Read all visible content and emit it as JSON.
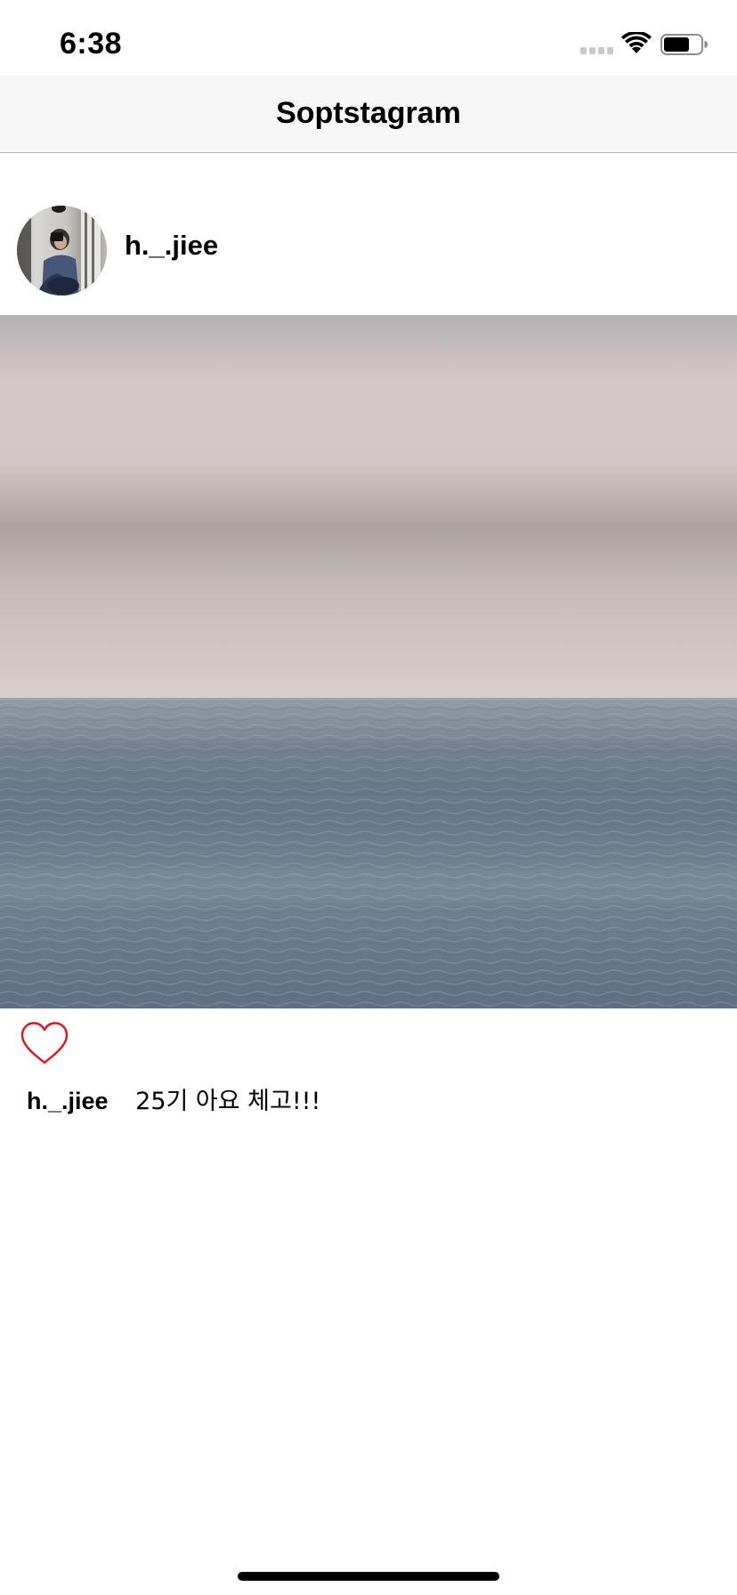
{
  "status_bar": {
    "time": "6:38",
    "icons": [
      "cellular-signal-icon",
      "wifi-icon",
      "battery-icon"
    ]
  },
  "nav_bar": {
    "title": "Soptstagram"
  },
  "post": {
    "username": "h._.jiee",
    "avatar_icon": "avatar-photo",
    "image_icon": "seascape-photo",
    "like_icon": "heart-outline-icon",
    "like_color": "#e0141e",
    "caption": {
      "username": "h._.jiee",
      "text": "25기 아요 체고!!!"
    }
  },
  "colors": {
    "nav_background": "#f7f7f7",
    "nav_border": "#b7b7b7",
    "heart": "#e0141e"
  }
}
